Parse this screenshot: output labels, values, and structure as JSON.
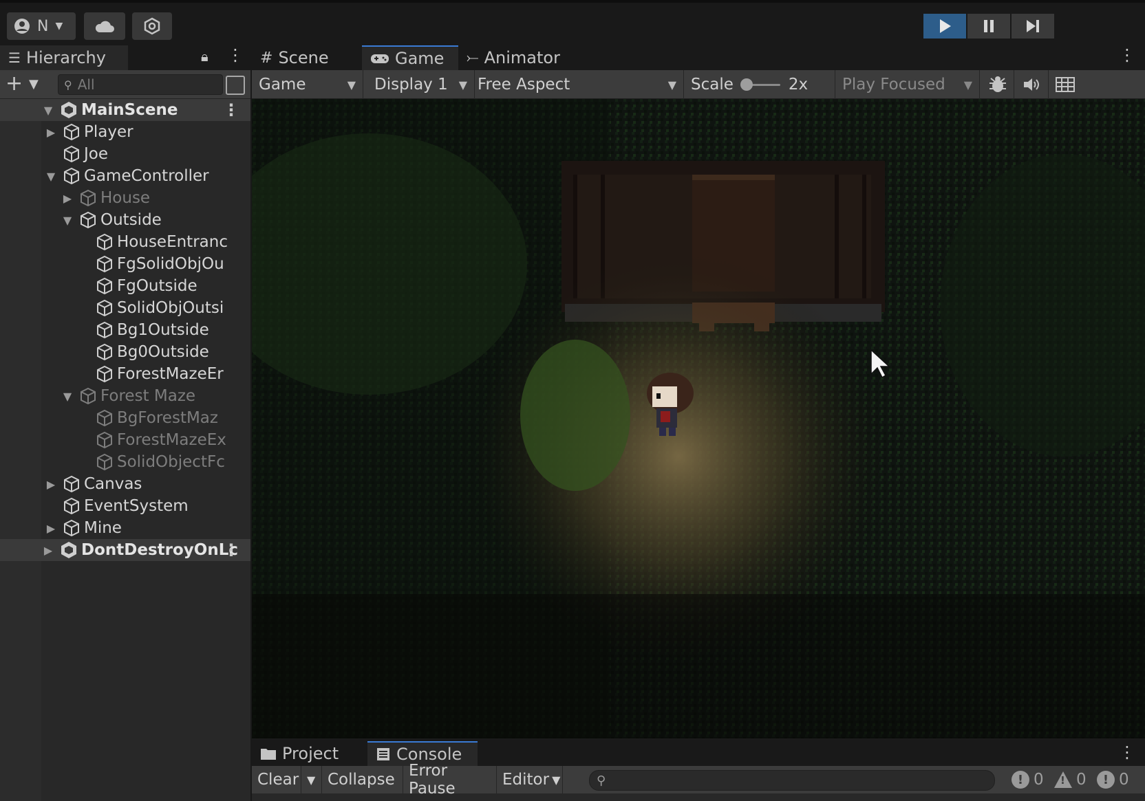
{
  "toolbar": {
    "account_label": "N",
    "account_icon": "user-icon",
    "cloud_icon": "cloud-icon",
    "collab_icon": "unity-services-icon",
    "play_state": "playing",
    "accent_color": "#2d5d8a"
  },
  "hierarchy": {
    "tab_label": "Hierarchy",
    "search_placeholder": "All",
    "rows": [
      {
        "label": "MainScene",
        "depth": 0,
        "expanded": true,
        "scene": true,
        "dim": false
      },
      {
        "label": "Player",
        "depth": 1,
        "expanded": false,
        "arrow": true,
        "dim": false
      },
      {
        "label": "Joe",
        "depth": 1,
        "arrow": false,
        "dim": false
      },
      {
        "label": "GameController",
        "depth": 1,
        "expanded": true,
        "arrow": true,
        "dim": false
      },
      {
        "label": "House",
        "depth": 2,
        "expanded": false,
        "arrow": true,
        "dim": true
      },
      {
        "label": "Outside",
        "depth": 2,
        "expanded": true,
        "arrow": true,
        "dim": false
      },
      {
        "label": "HouseEntranc",
        "depth": 3,
        "arrow": false,
        "dim": false
      },
      {
        "label": "FgSolidObjOu",
        "depth": 3,
        "arrow": false,
        "dim": false
      },
      {
        "label": "FgOutside",
        "depth": 3,
        "arrow": false,
        "dim": false
      },
      {
        "label": "SolidObjOutsi",
        "depth": 3,
        "arrow": false,
        "dim": false
      },
      {
        "label": "Bg1Outside",
        "depth": 3,
        "arrow": false,
        "dim": false
      },
      {
        "label": "Bg0Outside",
        "depth": 3,
        "arrow": false,
        "dim": false
      },
      {
        "label": "ForestMazeEr",
        "depth": 3,
        "arrow": false,
        "dim": false
      },
      {
        "label": "Forest Maze",
        "depth": 2,
        "expanded": true,
        "arrow": true,
        "dim": true
      },
      {
        "label": "BgForestMaz",
        "depth": 3,
        "arrow": false,
        "dim": true
      },
      {
        "label": "ForestMazeEx",
        "depth": 3,
        "arrow": false,
        "dim": true
      },
      {
        "label": "SolidObjectFc",
        "depth": 3,
        "arrow": false,
        "dim": true
      },
      {
        "label": "Canvas",
        "depth": 1,
        "expanded": false,
        "arrow": true,
        "dim": false
      },
      {
        "label": "EventSystem",
        "depth": 1,
        "arrow": false,
        "dim": false
      },
      {
        "label": "Mine",
        "depth": 1,
        "expanded": false,
        "arrow": true,
        "dim": false
      },
      {
        "label": "DontDestroyOnLc",
        "depth": 0,
        "expanded": false,
        "scene": true,
        "dim": false
      }
    ]
  },
  "game_view": {
    "tabs": [
      {
        "label": "Scene",
        "icon": "grid-hash-icon"
      },
      {
        "label": "Game",
        "icon": "gamepad-icon",
        "active": true
      },
      {
        "label": "Animator",
        "icon": "animator-icon"
      }
    ],
    "view_select": "Game",
    "display_select": "Display 1",
    "aspect_select": "Free Aspect",
    "scale_label": "Scale",
    "scale_value": "2x",
    "play_mode_select": "Play Focused"
  },
  "console": {
    "tabs": [
      {
        "label": "Project",
        "icon": "folder-icon"
      },
      {
        "label": "Console",
        "icon": "console-icon",
        "active": true
      }
    ],
    "clear_label": "Clear",
    "collapse_label": "Collapse",
    "error_pause_label": "Error Pause",
    "editor_label": "Editor",
    "log_count": "0",
    "warning_count": "0",
    "error_count": "0"
  }
}
